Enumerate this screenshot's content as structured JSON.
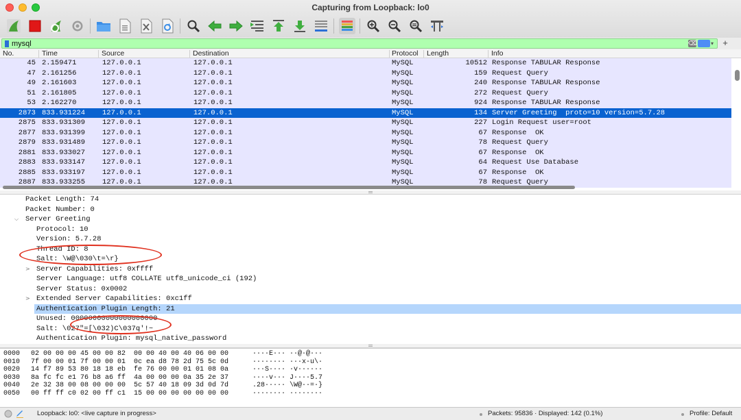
{
  "window": {
    "title": "Capturing from Loopback: lo0"
  },
  "colors": {
    "filter_bg": "#afffaf",
    "row_bg": "#e7e6ff",
    "selected_row": "#0a62d0",
    "detail_highlight": "#b5d6fc",
    "annotation": "#e0301e"
  },
  "toolbar": {
    "icons": [
      "shark-fin-start-icon",
      "stop-square-icon",
      "restart-fin-icon",
      "gear-options-icon",
      "folder-open-icon",
      "save-file-icon",
      "close-file-icon",
      "reload-icon",
      "find-magnifier-icon",
      "back-arrow-icon",
      "forward-arrow-icon",
      "go-to-packet-icon",
      "first-packet-icon",
      "last-packet-icon",
      "autoscroll-icon",
      "colorize-icon",
      "zoom-in-icon",
      "zoom-out-icon",
      "zoom-normal-icon",
      "resize-columns-icon"
    ]
  },
  "filter": {
    "value": "mysql",
    "clear_label": "⌫",
    "dropdown": "▾",
    "add_label": "+"
  },
  "packet_list": {
    "columns": {
      "no": "No.",
      "time": "Time",
      "source": "Source",
      "destination": "Destination",
      "protocol": "Protocol",
      "length": "Length",
      "info": "Info"
    },
    "rows": [
      {
        "no": "45",
        "time": "2.159471",
        "source": "127.0.0.1",
        "destination": "127.0.0.1",
        "protocol": "MySQL",
        "length": "10512",
        "info": "Response TABULAR Response"
      },
      {
        "no": "47",
        "time": "2.161256",
        "source": "127.0.0.1",
        "destination": "127.0.0.1",
        "protocol": "MySQL",
        "length": "159",
        "info": "Request Query"
      },
      {
        "no": "49",
        "time": "2.161603",
        "source": "127.0.0.1",
        "destination": "127.0.0.1",
        "protocol": "MySQL",
        "length": "240",
        "info": "Response TABULAR Response"
      },
      {
        "no": "51",
        "time": "2.161805",
        "source": "127.0.0.1",
        "destination": "127.0.0.1",
        "protocol": "MySQL",
        "length": "272",
        "info": "Request Query"
      },
      {
        "no": "53",
        "time": "2.162270",
        "source": "127.0.0.1",
        "destination": "127.0.0.1",
        "protocol": "MySQL",
        "length": "924",
        "info": "Response TABULAR Response"
      },
      {
        "no": "2873",
        "time": "833.931224",
        "source": "127.0.0.1",
        "destination": "127.0.0.1",
        "protocol": "MySQL",
        "length": "134",
        "info": "Server Greeting  proto=10 version=5.7.28",
        "selected": true
      },
      {
        "no": "2875",
        "time": "833.931309",
        "source": "127.0.0.1",
        "destination": "127.0.0.1",
        "protocol": "MySQL",
        "length": "227",
        "info": "Login Request user=root"
      },
      {
        "no": "2877",
        "time": "833.931399",
        "source": "127.0.0.1",
        "destination": "127.0.0.1",
        "protocol": "MySQL",
        "length": "67",
        "info": "Response  OK"
      },
      {
        "no": "2879",
        "time": "833.931489",
        "source": "127.0.0.1",
        "destination": "127.0.0.1",
        "protocol": "MySQL",
        "length": "78",
        "info": "Request Query"
      },
      {
        "no": "2881",
        "time": "833.933027",
        "source": "127.0.0.1",
        "destination": "127.0.0.1",
        "protocol": "MySQL",
        "length": "67",
        "info": "Response  OK"
      },
      {
        "no": "2883",
        "time": "833.933147",
        "source": "127.0.0.1",
        "destination": "127.0.0.1",
        "protocol": "MySQL",
        "length": "64",
        "info": "Request Use Database"
      },
      {
        "no": "2885",
        "time": "833.933197",
        "source": "127.0.0.1",
        "destination": "127.0.0.1",
        "protocol": "MySQL",
        "length": "67",
        "info": "Response  OK"
      },
      {
        "no": "2887",
        "time": "833.933255",
        "source": "127.0.0.1",
        "destination": "127.0.0.1",
        "protocol": "MySQL",
        "length": "78",
        "info": "Request Query"
      }
    ]
  },
  "details": {
    "rows": [
      {
        "indent": 0,
        "arrow": "",
        "text": "Packet Length: 74"
      },
      {
        "indent": 0,
        "arrow": "",
        "text": "Packet Number: 0"
      },
      {
        "indent": 0,
        "arrow": "⌵",
        "text": "Server Greeting"
      },
      {
        "indent": 1,
        "arrow": "",
        "text": "Protocol: 10"
      },
      {
        "indent": 1,
        "arrow": "",
        "text": "Version: 5.7.28"
      },
      {
        "indent": 1,
        "arrow": "",
        "text": "Thread ID: 8"
      },
      {
        "indent": 1,
        "arrow": "",
        "text": "Salt: \\W@\\030\\t=\\r}"
      },
      {
        "indent": 1,
        "arrow": ">",
        "text": "Server Capabilities: 0xffff"
      },
      {
        "indent": 1,
        "arrow": "",
        "text": "Server Language: utf8 COLLATE utf8_unicode_ci (192)"
      },
      {
        "indent": 1,
        "arrow": "",
        "text": "Server Status: 0x0002"
      },
      {
        "indent": 1,
        "arrow": ">",
        "text": "Extended Server Capabilities: 0xc1ff"
      },
      {
        "indent": 1,
        "arrow": "",
        "text": "Authentication Plugin Length: 21",
        "highlight": true
      },
      {
        "indent": 1,
        "arrow": "",
        "text": "Unused: 00000000000000000000"
      },
      {
        "indent": 1,
        "arrow": "",
        "text": "Salt: \\027\"=[\\032)C\\037q'!~"
      },
      {
        "indent": 1,
        "arrow": "",
        "text": "Authentication Plugin: mysql_native_password"
      }
    ]
  },
  "hex": {
    "rows": [
      {
        "offset": "0000",
        "hex": "02 00 00 00 45 00 00 82  00 00 40 00 40 06 00 00",
        "ascii": "····E··· ··@·@···"
      },
      {
        "offset": "0010",
        "hex": "7f 00 00 01 7f 00 00 01  0c ea d8 78 2d 75 5c 0d",
        "ascii": "········ ···x-u\\·"
      },
      {
        "offset": "0020",
        "hex": "14 f7 89 53 80 18 18 eb  fe 76 00 00 01 01 08 0a",
        "ascii": "···S···· ·v······"
      },
      {
        "offset": "0030",
        "hex": "8a fc fc e1 76 b8 a6 ff  4a 00 00 00 0a 35 2e 37",
        "ascii": "····v··· J····5.7"
      },
      {
        "offset": "0040",
        "hex": "2e 32 38 00 08 00 00 00  5c 57 40 18 09 3d 0d 7d",
        "ascii": ".28····· \\W@··=·}"
      },
      {
        "offset": "0050",
        "hex": "00 ff ff c0 02 00 ff c1  15 00 00 00 00 00 00 00",
        "ascii": "········ ········"
      }
    ]
  },
  "status": {
    "interface": "Loopback: lo0: <live capture in progress>",
    "packets": "Packets: 95836 · Displayed: 142 (0.1%)",
    "profile": "Profile: Default"
  }
}
